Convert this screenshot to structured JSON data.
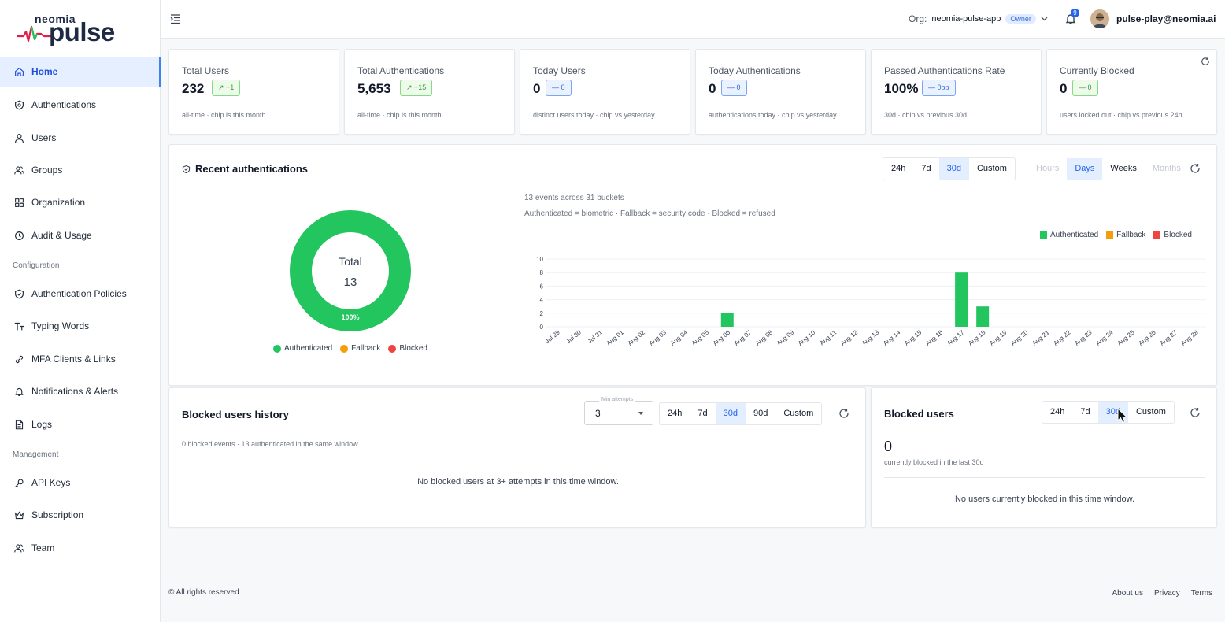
{
  "brand": {
    "top": "neomia",
    "main": "pulse"
  },
  "sidebar": {
    "items": [
      {
        "label": "Home",
        "icon": "home-icon"
      },
      {
        "label": "Authentications",
        "icon": "shield-icon"
      },
      {
        "label": "Users",
        "icon": "user-icon"
      },
      {
        "label": "Groups",
        "icon": "users-icon"
      },
      {
        "label": "Organization",
        "icon": "grid-icon"
      },
      {
        "label": "Audit & Usage",
        "icon": "clock-icon"
      }
    ],
    "config_section": "Configuration",
    "config_items": [
      {
        "label": "Authentication Policies",
        "icon": "shield-check-icon"
      },
      {
        "label": "Typing Words",
        "icon": "text-size-icon"
      },
      {
        "label": "MFA Clients & Links",
        "icon": "link-icon"
      },
      {
        "label": "Notifications & Alerts",
        "icon": "bell-icon"
      },
      {
        "label": "Logs",
        "icon": "file-icon"
      }
    ],
    "management_section": "Management",
    "management_items": [
      {
        "label": "API Keys",
        "icon": "key-icon"
      },
      {
        "label": "Subscription",
        "icon": "crown-icon"
      },
      {
        "label": "Team",
        "icon": "team-icon"
      }
    ]
  },
  "header": {
    "org_label": "Org:",
    "org_name": "neomia-pulse-app",
    "role": "Owner",
    "notifications": "9",
    "user_email": "pulse-play@neomia.ai"
  },
  "kpis": [
    {
      "title": "Total Users",
      "value": "232",
      "chip": "↗ +1",
      "chip_color": "green",
      "sub": "all-time · chip is this month"
    },
    {
      "title": "Total Authentications",
      "value": "5,653",
      "chip": "↗ +15",
      "chip_color": "green",
      "sub": "all-time · chip is this month"
    },
    {
      "title": "Today Users",
      "value": "0",
      "chip": "— 0",
      "chip_color": "blue",
      "sub": "distinct users today · chip vs yesterday"
    },
    {
      "title": "Today Authentications",
      "value": "0",
      "chip": "— 0",
      "chip_color": "blue",
      "sub": "authentications today · chip vs yesterday"
    },
    {
      "title": "Passed Authentications Rate",
      "value": "100%",
      "chip": "— 0pp",
      "chip_color": "blue",
      "sub": "30d · chip vs previous 30d"
    },
    {
      "title": "Currently Blocked",
      "value": "0",
      "chip": "— 0",
      "chip_color": "green",
      "sub": "users locked out · chip vs previous 24h"
    }
  ],
  "recent": {
    "title": "Recent authentications",
    "ranges": [
      "24h",
      "7d",
      "30d",
      "Custom"
    ],
    "selected_range": "30d",
    "granularity": [
      "Hours",
      "Days",
      "Weeks",
      "Months"
    ],
    "selected_granularity": "Days",
    "donut_total_label": "Total",
    "donut_total": "13",
    "donut_pct": "100%",
    "note1": "13 events across 31 buckets",
    "note2": "Authenticated = biometric · Fallback = security code · Blocked = refused",
    "legend": [
      {
        "name": "Authenticated",
        "color": "#22c55e"
      },
      {
        "name": "Fallback",
        "color": "#f59e0b"
      },
      {
        "name": "Blocked",
        "color": "#ef4444"
      }
    ]
  },
  "chart_data": {
    "type": "bar",
    "categories": [
      "Jul 29",
      "Jul 30",
      "Jul 31",
      "Aug 01",
      "Aug 02",
      "Aug 03",
      "Aug 04",
      "Aug 05",
      "Aug 06",
      "Aug 07",
      "Aug 08",
      "Aug 09",
      "Aug 10",
      "Aug 11",
      "Aug 12",
      "Aug 13",
      "Aug 14",
      "Aug 15",
      "Aug 16",
      "Aug 17",
      "Aug 18",
      "Aug 19",
      "Aug 20",
      "Aug 21",
      "Aug 22",
      "Aug 23",
      "Aug 24",
      "Aug 25",
      "Aug 26",
      "Aug 27",
      "Aug 28"
    ],
    "series": [
      {
        "name": "Authenticated",
        "color": "#22c55e",
        "values": [
          0,
          0,
          0,
          0,
          0,
          0,
          0,
          0,
          2,
          0,
          0,
          0,
          0,
          0,
          0,
          0,
          0,
          0,
          0,
          8,
          3,
          0,
          0,
          0,
          0,
          0,
          0,
          0,
          0,
          0,
          0
        ]
      },
      {
        "name": "Fallback",
        "color": "#f59e0b",
        "values": [
          0,
          0,
          0,
          0,
          0,
          0,
          0,
          0,
          0,
          0,
          0,
          0,
          0,
          0,
          0,
          0,
          0,
          0,
          0,
          0,
          0,
          0,
          0,
          0,
          0,
          0,
          0,
          0,
          0,
          0,
          0
        ]
      },
      {
        "name": "Blocked",
        "color": "#ef4444",
        "values": [
          0,
          0,
          0,
          0,
          0,
          0,
          0,
          0,
          0,
          0,
          0,
          0,
          0,
          0,
          0,
          0,
          0,
          0,
          0,
          0,
          0,
          0,
          0,
          0,
          0,
          0,
          0,
          0,
          0,
          0,
          0
        ]
      }
    ],
    "yticks": [
      0,
      2,
      4,
      6,
      8,
      10
    ],
    "ylim": [
      0,
      10
    ],
    "grid": true,
    "legend_position": "top-right"
  },
  "blocked_history": {
    "title": "Blocked users history",
    "select_label": "Min attempts",
    "select_value": "3",
    "ranges": [
      "24h",
      "7d",
      "30d",
      "90d",
      "Custom"
    ],
    "selected_range": "30d",
    "sub": "0 blocked events · 13 authenticated in the same window",
    "empty": "No blocked users at 3+ attempts in this time window."
  },
  "blocked_users": {
    "title": "Blocked users",
    "ranges": [
      "24h",
      "7d",
      "30d",
      "Custom"
    ],
    "selected_range": "30d",
    "count": "0",
    "sub": "currently blocked in the last 30d",
    "empty": "No users currently blocked in this time window."
  },
  "footer": {
    "copyright": "© All rights reserved",
    "links": [
      "About us",
      "Privacy",
      "Terms"
    ]
  }
}
